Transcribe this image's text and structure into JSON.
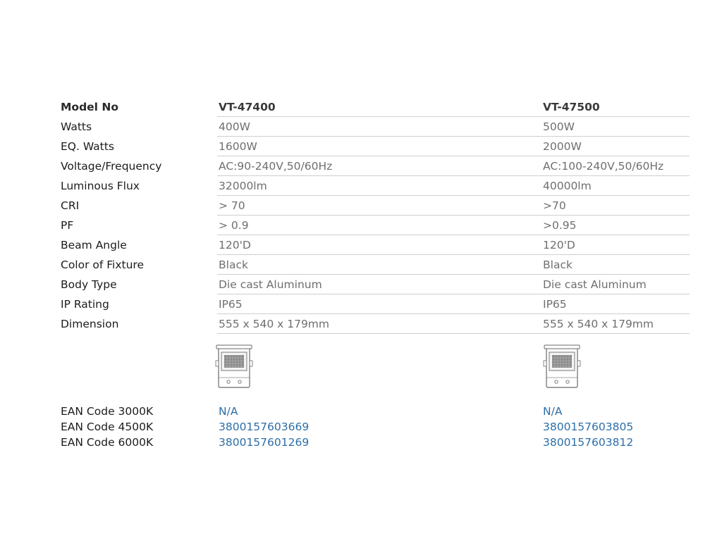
{
  "spec": {
    "header": {
      "label": "Model No",
      "model1": "VT-47400",
      "model2": "VT-47500"
    },
    "rows": [
      {
        "label": "Watts",
        "v1": "400W",
        "v2": "500W"
      },
      {
        "label": "EQ. Watts",
        "v1": "1600W",
        "v2": "2000W"
      },
      {
        "label": "Voltage/Frequency",
        "v1": "AC:90-240V,50/60Hz",
        "v2": "AC:100-240V,50/60Hz"
      },
      {
        "label": "Luminous Flux",
        "v1": "32000lm",
        "v2": "40000lm"
      },
      {
        "label": "CRI",
        "v1": "> 70",
        "v2": ">70"
      },
      {
        "label": "PF",
        "v1": "> 0.9",
        "v2": ">0.95"
      },
      {
        "label": "Beam Angle",
        "v1": "120'D",
        "v2": "120'D"
      },
      {
        "label": "Color of Fixture",
        "v1": "Black",
        "v2": "Black"
      },
      {
        "label": "Body Type",
        "v1": "Die cast Aluminum",
        "v2": "Die cast Aluminum"
      },
      {
        "label": "IP Rating",
        "v1": "IP65",
        "v2": "IP65"
      },
      {
        "label": "Dimension",
        "v1": "555 x 540 x 179mm",
        "v2": "555 x 540 x 179mm"
      }
    ]
  },
  "ean": [
    {
      "label": "EAN Code 3000K",
      "v1": "N/A",
      "v2": "N/A"
    },
    {
      "label": "EAN Code 4500K",
      "v1": "3800157603669",
      "v2": "3800157603805"
    },
    {
      "label": "EAN Code 6000K",
      "v1": "3800157601269",
      "v2": "3800157603812"
    }
  ],
  "colors": {
    "link": "#2d6ea8",
    "label": "#1c1c1c",
    "value": "#6f6f6f",
    "rule": "#cfcfcf"
  },
  "icons": {
    "fixture": "floodlight-fixture-icon"
  }
}
